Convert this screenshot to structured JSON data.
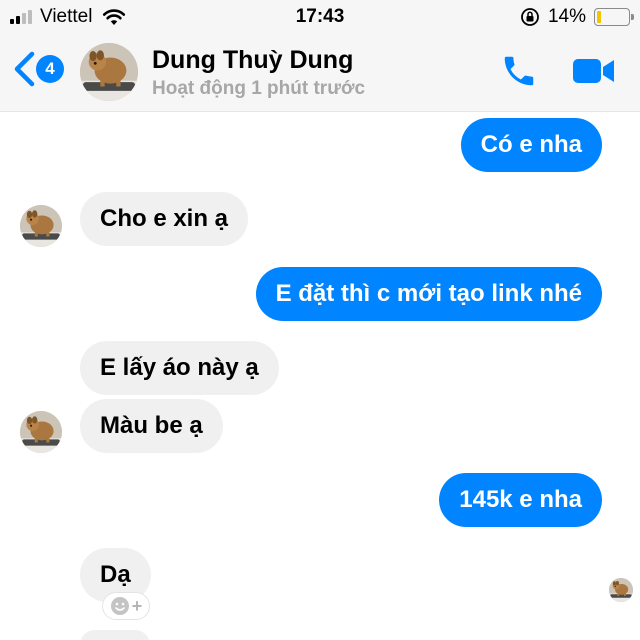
{
  "status_bar": {
    "carrier": "Viettel",
    "time": "17:43",
    "battery_percent": "14%",
    "battery_level": 0.14,
    "signal_bars": 2,
    "icons": [
      "signal-icon",
      "wifi-icon",
      "orientation-lock-icon",
      "battery-icon"
    ]
  },
  "header": {
    "back_badge": "4",
    "contact_name": "Dung Thuỳ Dung",
    "activity_status": "Hoạt động 1 phút trước",
    "icons": [
      "back-chevron-icon",
      "phone-icon",
      "video-camera-icon"
    ]
  },
  "messages": [
    {
      "direction": "outgoing",
      "text": "Có e nha"
    },
    {
      "direction": "incoming",
      "text": "Cho e xin ạ"
    },
    {
      "direction": "outgoing",
      "text": "E đặt thì c mới tạo link nhé"
    },
    {
      "direction": "incoming",
      "text": "E lấy áo này ạ"
    },
    {
      "direction": "incoming",
      "text": "Màu be ạ"
    },
    {
      "direction": "outgoing",
      "text": "145k e nha"
    },
    {
      "direction": "incoming",
      "text": "Dạ"
    }
  ],
  "colors": {
    "accent": "#0084ff",
    "incoming_bubble": "#f1f0f0",
    "header_bg": "#f6f6f6",
    "muted_text": "#a7a7a7",
    "battery": "#f5c400"
  }
}
